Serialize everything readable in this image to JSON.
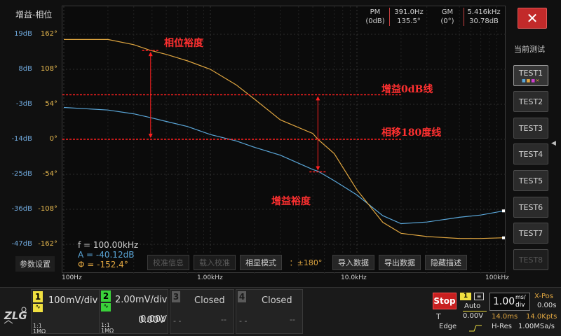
{
  "app": {
    "title": "增益-相位"
  },
  "axes": {
    "db_labels": [
      "19dB",
      "8dB",
      "-3dB",
      "-14dB",
      "-25dB",
      "-36dB",
      "-47dB"
    ],
    "phase_labels": [
      "162°",
      "108°",
      "54°",
      "0°",
      "-54°",
      "-108°",
      "-162°"
    ],
    "x_labels": [
      "100Hz",
      "1.00kHz",
      "10.0kHz",
      "100kHz"
    ]
  },
  "measure": {
    "pm_label": "PM",
    "pm_ref": "(0dB)",
    "pm_freq": "391.0Hz",
    "pm_value": "135.5°",
    "gm_label": "GM",
    "gm_ref": "(0°)",
    "gm_freq": "5.416kHz",
    "gm_value": "30.78dB"
  },
  "annotations": {
    "phase_margin": "相位裕度",
    "gain_zero": "增益0dB线",
    "phase_180": "相移180度线",
    "gain_margin": "增益裕度"
  },
  "cursor": {
    "f": "f = 100.00kHz",
    "a": "A = -40.12dB",
    "phi": "Φ = -152.4°"
  },
  "toolbar": {
    "params": "参数设置",
    "calib_info": "校准信息",
    "load_calib": "载入校准",
    "phase_mode": "相显模式",
    "phase_mode_value": "：±180°",
    "import": "导入数据",
    "export": "导出数据",
    "hide_desc": "隐藏描述"
  },
  "right_panel": {
    "close": "✕",
    "current_test": "当前测试",
    "tests": [
      "TEST1",
      "TEST2",
      "TEST3",
      "TEST4",
      "TEST5",
      "TEST6",
      "TEST7",
      "TEST8"
    ]
  },
  "channels": [
    {
      "num": "1",
      "scale": "100mV/div",
      "offset": "0.00V",
      "coupling": "1:1",
      "impedance": "1MΩ",
      "color": "#f0e040"
    },
    {
      "num": "2",
      "scale": "2.00mV/div",
      "offset": "0.00V",
      "coupling": "1:1",
      "impedance": "1MΩ",
      "color": "#3ad13a"
    },
    {
      "num": "3",
      "state": "Closed",
      "dash1": "- -",
      "dash2": "--"
    },
    {
      "num": "4",
      "state": "Closed",
      "dash1": "- -",
      "dash2": "--"
    }
  ],
  "trigger": {
    "stop": "Stop",
    "source": "1",
    "mode": "Auto",
    "type": "T",
    "level": "0.00V",
    "edge": "Edge"
  },
  "timebase": {
    "scale": "1.00",
    "unit_top": "ms/",
    "unit_bottom": "div",
    "xpos_label": "X-Pos",
    "xpos_value": "0.00s",
    "window": "14.0ms",
    "points": "14.0Kpts",
    "hres": "H-Res",
    "rate": "1.00MSa/s"
  },
  "colors": {
    "gain": "#5aa6d8",
    "phase": "#e0a640",
    "annotation": "#ff2020"
  },
  "chart_data": {
    "type": "line",
    "x_scale": "log",
    "xlim": [
      100,
      100000
    ],
    "ylim_gain_db": [
      -47,
      19
    ],
    "ylim_phase_deg": [
      -162,
      162
    ],
    "series": [
      {
        "axis": "gain",
        "x": [
          100,
          200,
          300,
          391,
          500,
          700,
          1000,
          1500,
          2000,
          3000,
          5000,
          5416,
          7000,
          10000,
          15000,
          20000,
          30000,
          50000,
          70000,
          100000
        ],
        "values": [
          -4,
          -4.8,
          -6,
          -7.2,
          -8.4,
          -10,
          -12.5,
          -14.5,
          -16.5,
          -19,
          -23.5,
          -24,
          -27,
          -31.5,
          -38,
          -40.5,
          -40,
          -38.5,
          -37.8,
          -36.5
        ]
      },
      {
        "axis": "phase",
        "x": [
          100,
          200,
          300,
          391,
          500,
          700,
          1000,
          1500,
          2000,
          3000,
          5000,
          5416,
          7000,
          10000,
          15000,
          20000,
          30000,
          50000,
          70000,
          100000
        ],
        "values": [
          154,
          154,
          146,
          137,
          131,
          121,
          108,
          84,
          62,
          30,
          9,
          0,
          -22,
          -78,
          -128,
          -145,
          -150,
          -153,
          -153,
          -152
        ]
      }
    ]
  }
}
